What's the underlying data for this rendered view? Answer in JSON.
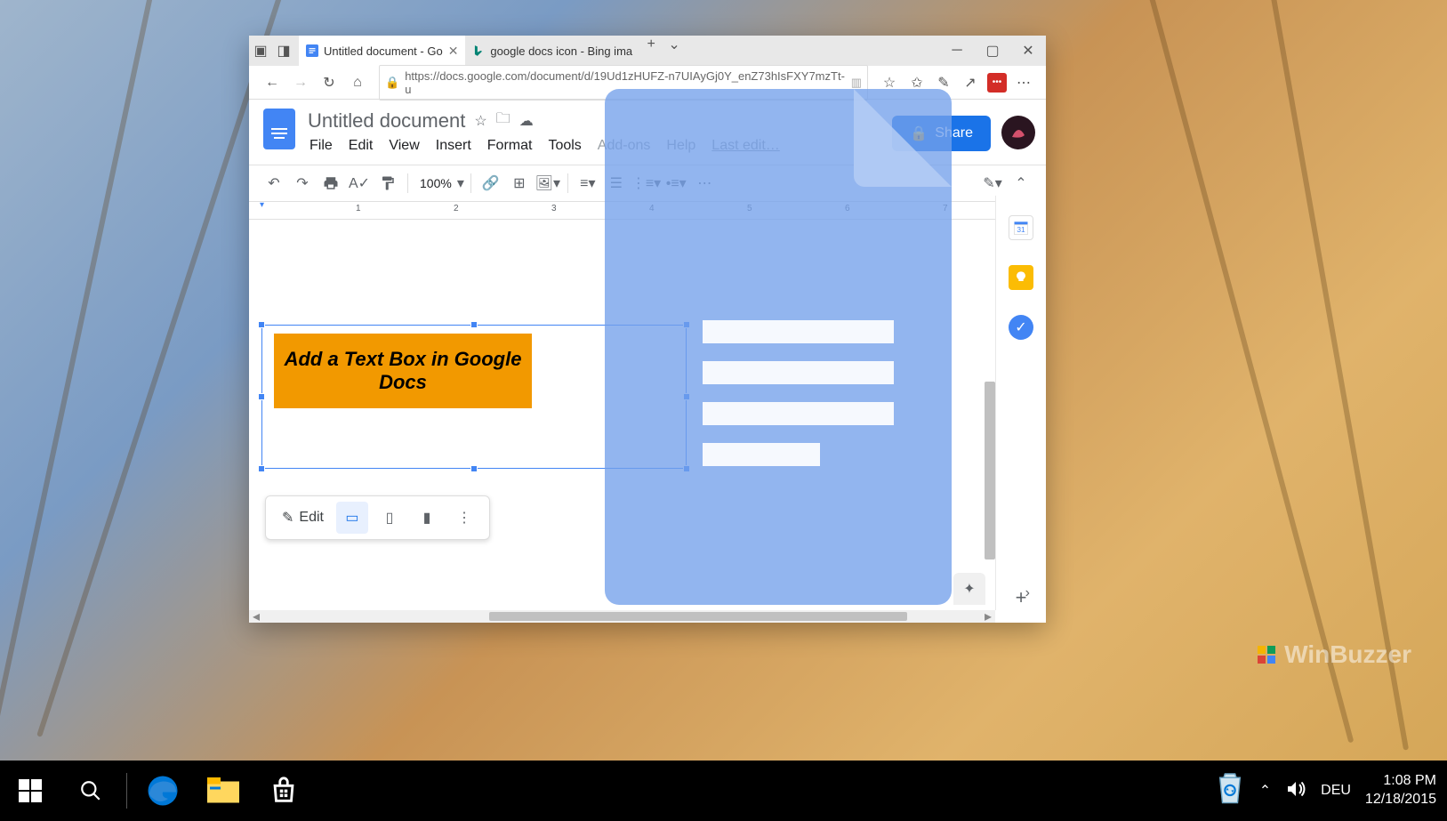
{
  "browser": {
    "tabs": [
      {
        "label": "Untitled document - Go",
        "active": true
      },
      {
        "label": "google docs icon - Bing ima",
        "active": false
      }
    ],
    "url": "https://docs.google.com/document/d/19Ud1zHUFZ-n7UIAyGj0Y_enZ73hIsFXY7mzTt-u"
  },
  "doc": {
    "title": "Untitled document",
    "menu": [
      "File",
      "Edit",
      "View",
      "Insert",
      "Format",
      "Tools",
      "Add-ons",
      "Help"
    ],
    "last_edit": "Last edit…",
    "share": "Share",
    "zoom": "100%",
    "ruler": [
      "1",
      "2",
      "3",
      "4",
      "5",
      "6",
      "7"
    ],
    "textbox": "Add a Text Box in Google Docs",
    "float_edit": "Edit"
  },
  "taskbar": {
    "lang": "DEU",
    "time": "1:08 PM",
    "date": "12/18/2015"
  },
  "watermark": "WinBuzzer"
}
